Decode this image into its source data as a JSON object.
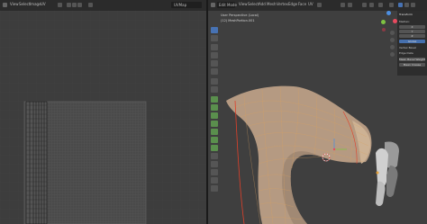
{
  "app": "Blender",
  "uv_editor": {
    "menus": [
      "View",
      "Select",
      "Image",
      "UV"
    ],
    "image_field": "UVMap"
  },
  "viewport": {
    "header": {
      "mode": "Edit Mode",
      "menus": [
        "View",
        "Select",
        "Add",
        "Mesh",
        "Vertex",
        "Edge",
        "Face",
        "UV"
      ]
    },
    "overlay_lines": [
      "User Perspective (Local)",
      "(12) MeshPortion.001"
    ],
    "npanel": {
      "tab": "Transform",
      "rows": [
        "Median:",
        "X",
        "Y",
        "Z",
        "Global",
        "Vertex Bevel",
        "Edge Data",
        "Mean Bevel Weight",
        "Mean Crease"
      ]
    }
  },
  "colors": {
    "accent": "#4772b3",
    "mesh_fill": "#b59a82",
    "mesh_wire": "#d8a060",
    "seam": "#e0402a",
    "x_axis": "#e84a5f",
    "y_axis": "#7fc242",
    "z_axis": "#4d8fe0"
  }
}
